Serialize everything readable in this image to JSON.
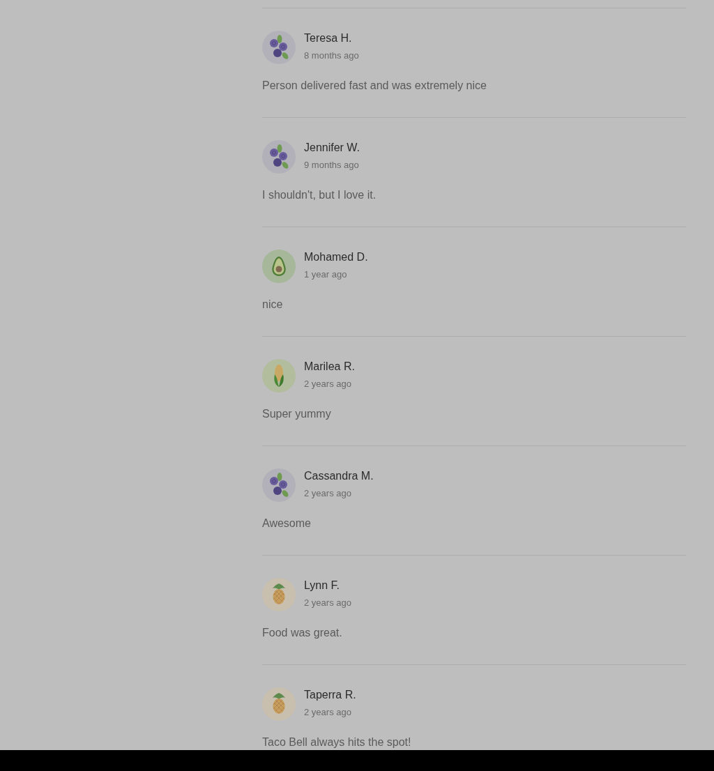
{
  "reviews": [
    {
      "name": "Teresa H.",
      "time": "8 months ago",
      "text": "Person delivered fast and was extremely nice",
      "avatar": {
        "kind": "blueberries"
      }
    },
    {
      "name": "Jennifer W.",
      "time": "9 months ago",
      "text": "I shouldn't, but I love it.",
      "avatar": {
        "kind": "blueberries"
      }
    },
    {
      "name": "Mohamed D.",
      "time": "1 year ago",
      "text": "nice",
      "avatar": {
        "kind": "avocado"
      }
    },
    {
      "name": "Marilea R.",
      "time": "2 years ago",
      "text": "Super yummy",
      "avatar": {
        "kind": "corn"
      }
    },
    {
      "name": "Cassandra M.",
      "time": "2 years ago",
      "text": "Awesome",
      "avatar": {
        "kind": "blueberries"
      }
    },
    {
      "name": "Lynn F.",
      "time": "2 years ago",
      "text": "Food was great.",
      "avatar": {
        "kind": "pineapple"
      }
    },
    {
      "name": "Taperra R.",
      "time": "2 years ago",
      "text": "Taco Bell always hits the spot!",
      "avatar": {
        "kind": "pineapple"
      }
    }
  ]
}
